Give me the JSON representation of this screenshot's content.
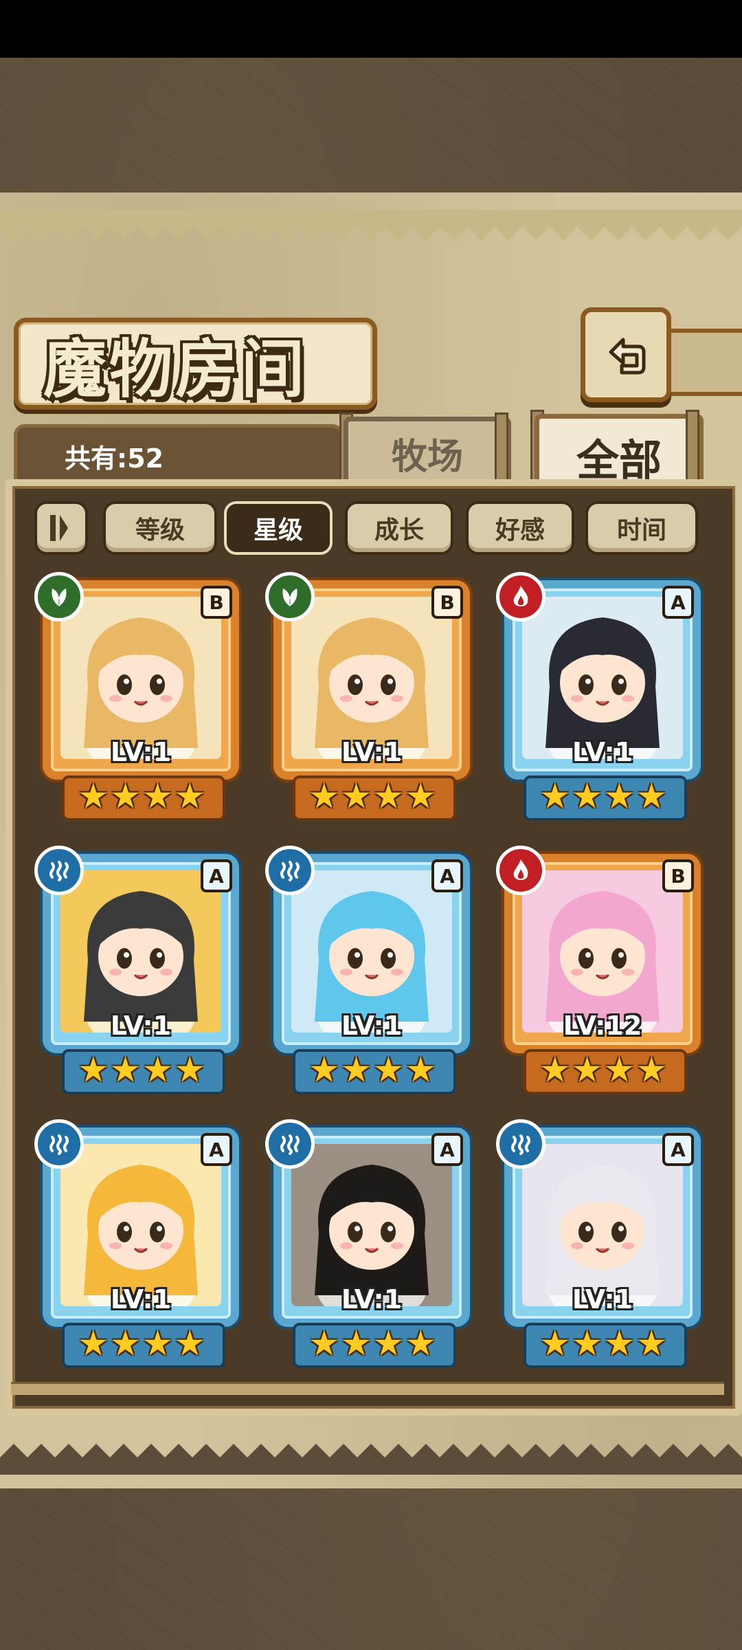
{
  "title": "魔物房间",
  "count_label": "共有:52",
  "tabs": [
    {
      "label": "牧场",
      "selected": false
    },
    {
      "label": "全部",
      "selected": true
    }
  ],
  "sort_options": [
    {
      "label": "等级",
      "active": false
    },
    {
      "label": "星级",
      "active": true
    },
    {
      "label": "成长",
      "active": false
    },
    {
      "label": "好感",
      "active": false
    },
    {
      "label": "时间",
      "active": false
    }
  ],
  "monsters": [
    {
      "level": "LV:1",
      "element": "grass",
      "rank": "B",
      "frame": "orange",
      "stars": 4,
      "hair": "#e8b865",
      "bg": "#f7e3b9"
    },
    {
      "level": "LV:1",
      "element": "grass",
      "rank": "B",
      "frame": "orange",
      "stars": 4,
      "hair": "#e8b865",
      "bg": "#f7e3b9"
    },
    {
      "level": "LV:1",
      "element": "fire",
      "rank": "A",
      "frame": "blue",
      "stars": 4,
      "hair": "#2a2a33",
      "bg": "#dceaf2"
    },
    {
      "level": "LV:1",
      "element": "water",
      "rank": "A",
      "frame": "blue",
      "stars": 4,
      "hair": "#3b3b3b",
      "bg": "#f2c95a"
    },
    {
      "level": "LV:1",
      "element": "water",
      "rank": "A",
      "frame": "blue",
      "stars": 4,
      "hair": "#5fc7ec",
      "bg": "#cfe9f6"
    },
    {
      "level": "LV:12",
      "element": "fire",
      "rank": "B",
      "frame": "orange",
      "stars": 4,
      "hair": "#f3a7cf",
      "bg": "#f6cbe0"
    },
    {
      "level": "LV:1",
      "element": "water",
      "rank": "A",
      "frame": "blue",
      "stars": 4,
      "hair": "#f5b83a",
      "bg": "#fbe7b0"
    },
    {
      "level": "LV:1",
      "element": "water",
      "rank": "A",
      "frame": "blue",
      "stars": 4,
      "hair": "#1e1a18",
      "bg": "#9a8f82"
    },
    {
      "level": "LV:1",
      "element": "water",
      "rank": "A",
      "frame": "blue",
      "stars": 4,
      "hair": "#e9e9ef",
      "bg": "#e7e4ee"
    }
  ]
}
